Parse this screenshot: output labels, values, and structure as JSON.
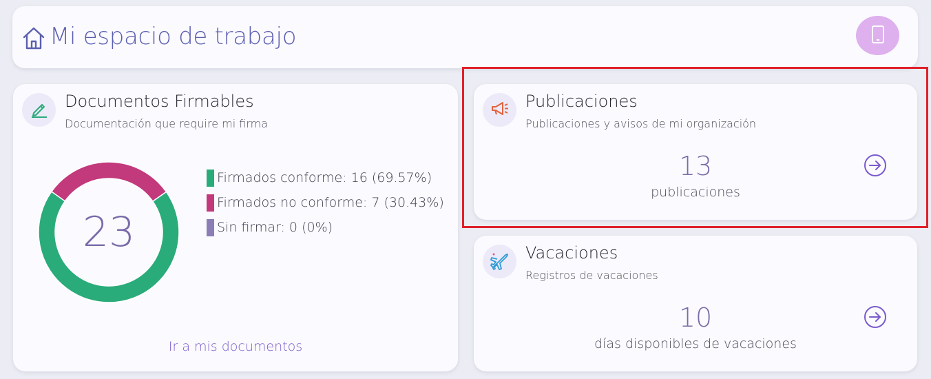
{
  "header": {
    "title": "Mi espacio de trabajo",
    "home_icon": "home-icon",
    "device_button_icon": "tablet-icon",
    "device_button_color": "#deb0ee"
  },
  "documents": {
    "title": "Documentos Firmables",
    "subtitle": "Documentación que require mi firma",
    "icon": "pen-icon",
    "total": "23",
    "link": "Ir a mis documentos",
    "chart_data": {
      "type": "pie",
      "donut": true,
      "center_label": "23",
      "series": [
        {
          "name": "Firmados conforme: 16 (69.57%)",
          "value": 16,
          "color": "#2aab7a"
        },
        {
          "name": "Firmados no conforme: 7 (30.43%)",
          "value": 7,
          "color": "#c2397c"
        },
        {
          "name": "Sin firmar: 0 (0%)",
          "value": 0,
          "color": "#8b7eb5"
        }
      ]
    }
  },
  "publications": {
    "title": "Publicaciones",
    "subtitle": "Publicaciones y avisos de mi organización",
    "icon": "megaphone-icon",
    "count": "13",
    "count_label": "publicaciones",
    "arrow_icon": "arrow-right-circle-icon"
  },
  "vacations": {
    "title": "Vacaciones",
    "subtitle": "Registros de vacaciones",
    "icon": "airplane-icon",
    "count": "10",
    "count_label": "días disponibles de vacaciones",
    "arrow_icon": "arrow-right-circle-icon"
  },
  "colors": {
    "accent": "#5b5fb0",
    "highlight_border": "#e0202a"
  }
}
